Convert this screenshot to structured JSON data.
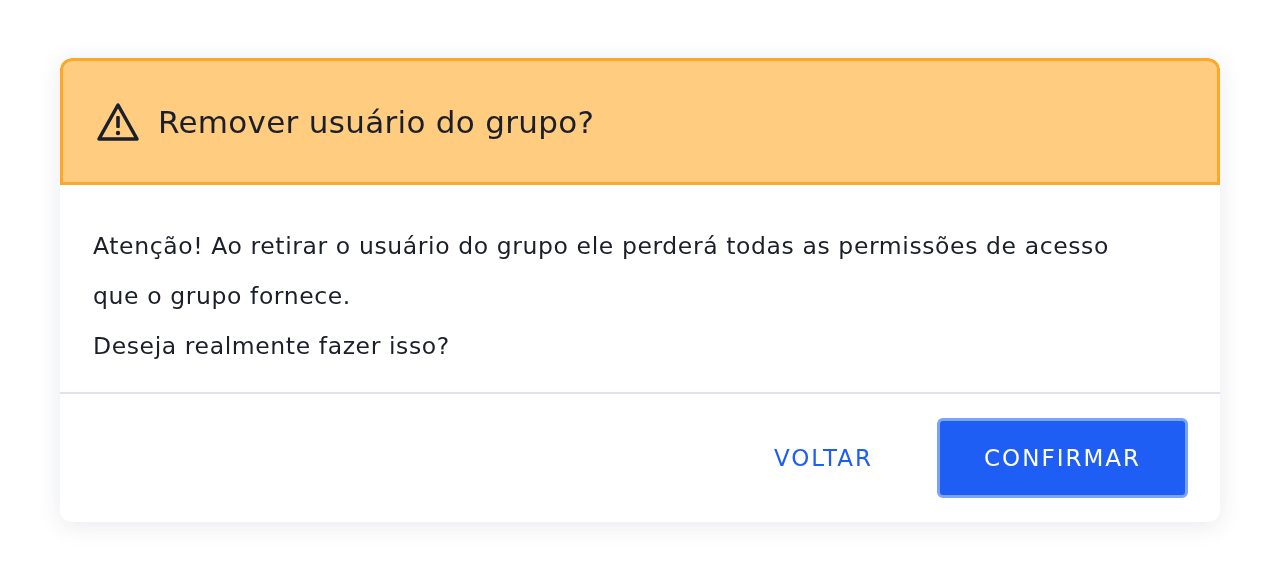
{
  "dialog": {
    "title": "Remover usuário do grupo?",
    "message": [
      "Atenção! Ao retirar o usuário do grupo ele perderá todas as permissões de acesso que o grupo fornece.",
      "Deseja realmente fazer isso?"
    ],
    "buttons": [
      {
        "label": "VOLTAR",
        "kind": "text"
      },
      {
        "label": "CONFIRMAR",
        "kind": "primary"
      }
    ]
  }
}
